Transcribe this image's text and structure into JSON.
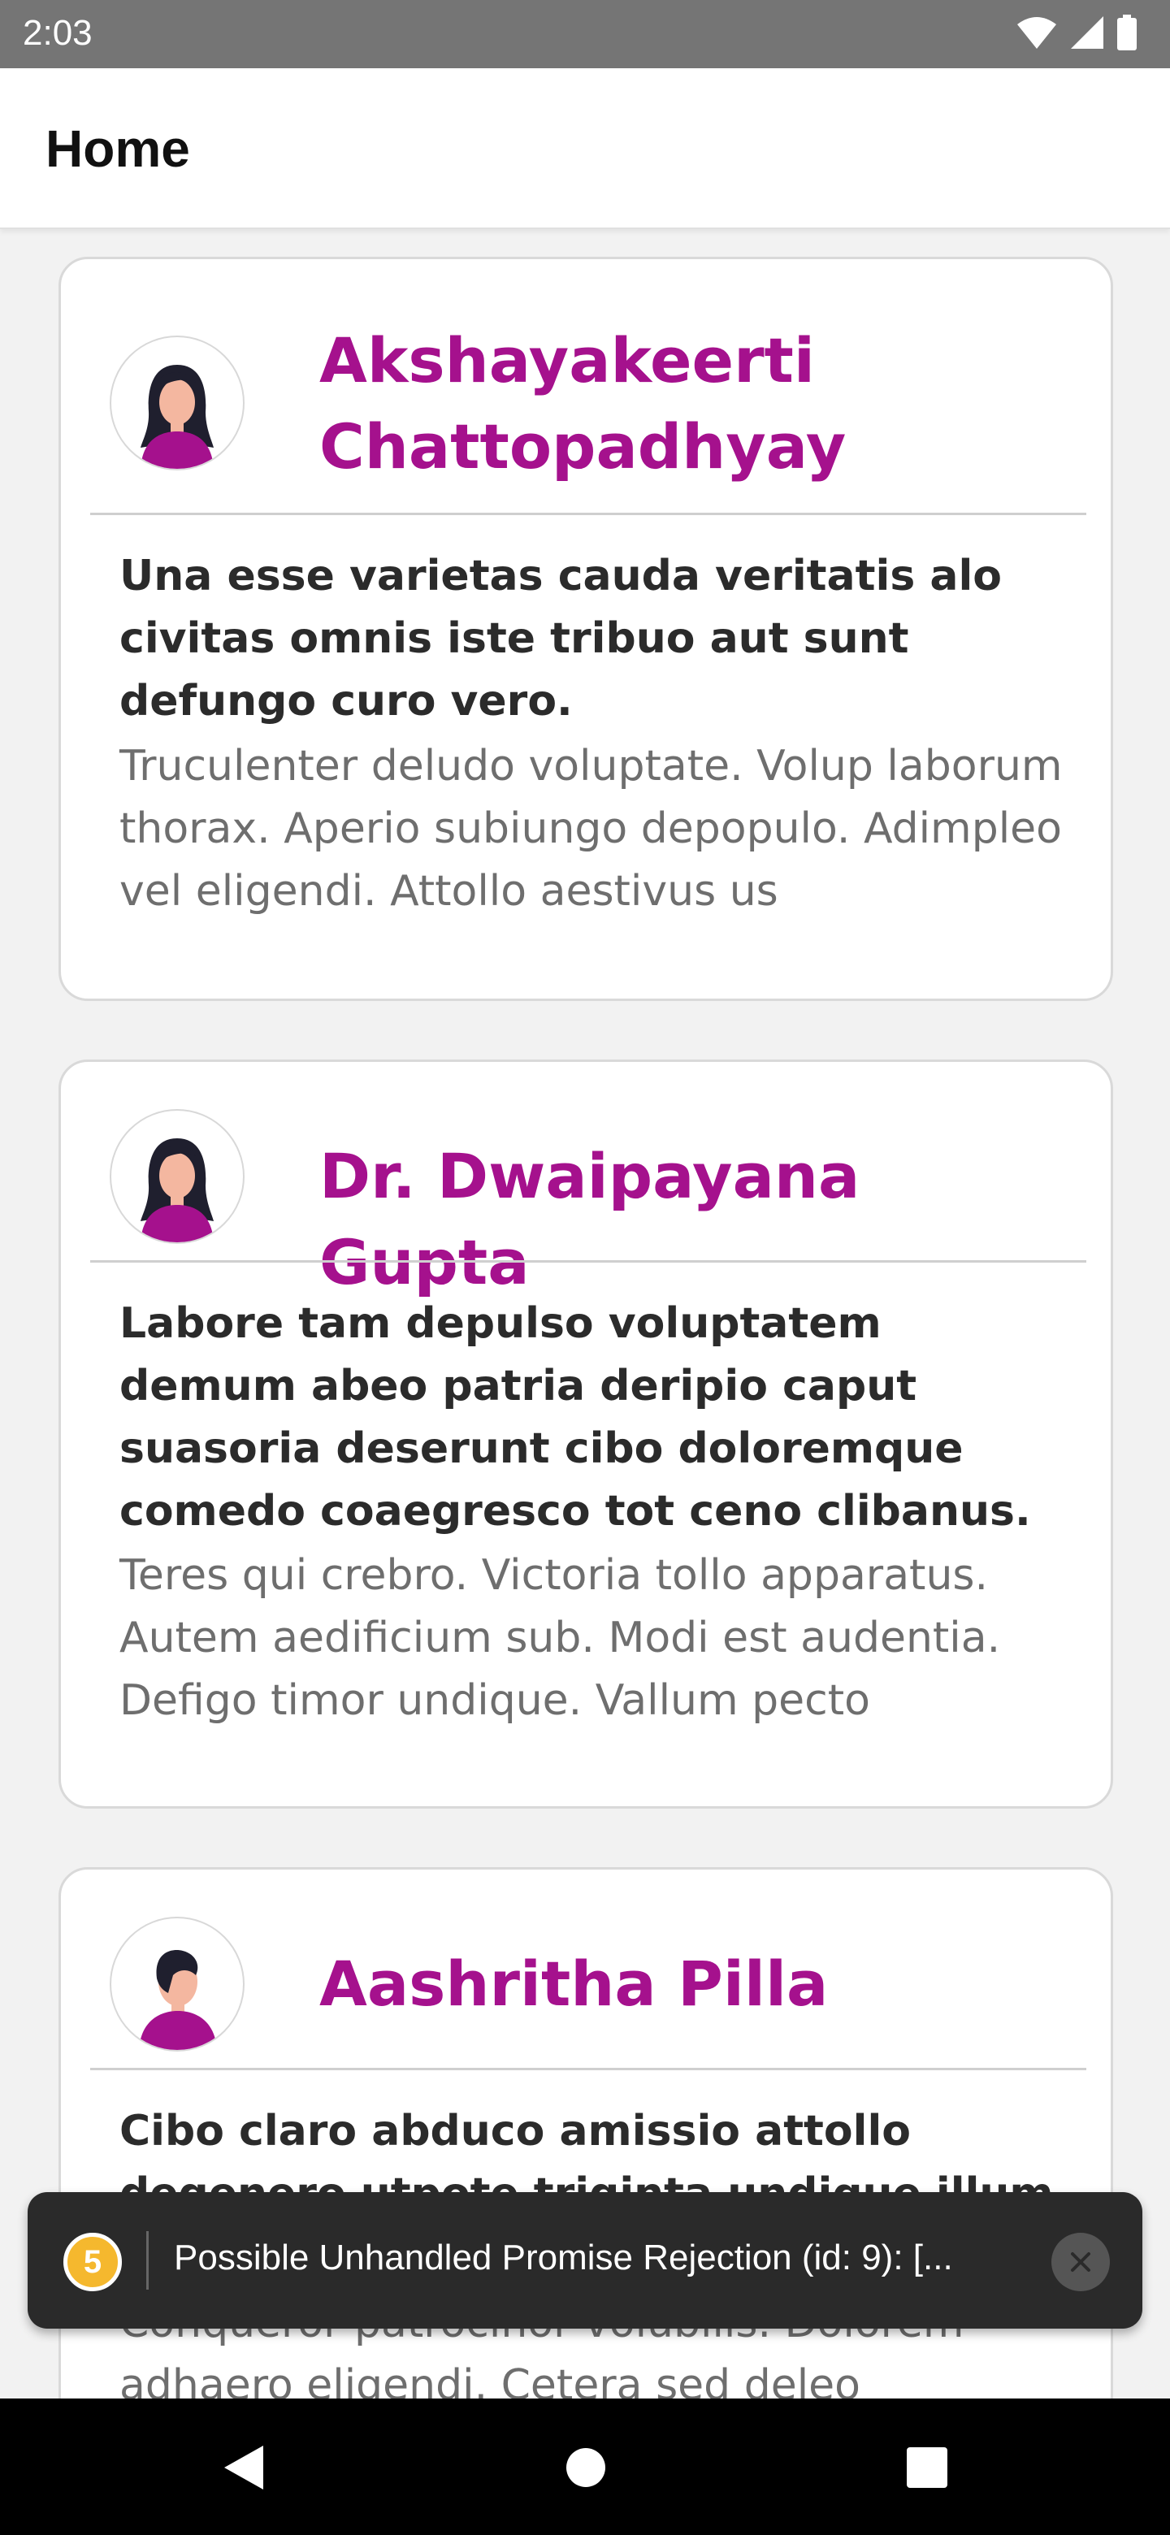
{
  "status_bar": {
    "time": "2:03",
    "icons": [
      "wifi-icon",
      "signal-icon",
      "battery-icon"
    ]
  },
  "app_bar": {
    "title": "Home"
  },
  "posts": [
    {
      "author": "Akshayakeerti Chattopadhyay",
      "avatar": "avatar-woman-long-hair",
      "title": "Una esse varietas cauda veritatis alo civitas omnis iste tribuo aut sunt defungo curo vero.",
      "body": "Truculenter deludo voluptate. Volup laborum thorax. Aperio subiungo depopulo. Adimpleo vel eligendi. Attollo aestivus us"
    },
    {
      "author": "Dr. Dwaipayana Gupta",
      "avatar": "avatar-woman-long-hair",
      "title": "Labore tam depulso voluptatem demum abeo patria deripio caput suasoria deserunt cibo doloremque comedo coaegresco tot ceno clibanus.",
      "body": "Teres qui crebro. Victoria tollo apparatus. Autem aedificium sub. Modi est audentia. Defigo timor undique. Vallum pecto"
    },
    {
      "author": "Aashritha Pilla",
      "avatar": "avatar-man-short-hair",
      "title": "Cibo claro abduco amissio attollo degenero utpote triginta undique illum",
      "body": "Conqueror patrocinor volubilis. Dolorem adhaero eligendi. Cetera sed deleo"
    }
  ],
  "toast": {
    "count": "5",
    "message": "Possible Unhandled Promise Rejection (id: 9): [..."
  },
  "nav": {
    "icons": [
      "back-icon",
      "home-icon",
      "recents-icon"
    ]
  },
  "colors": {
    "accent": "#a5118d",
    "status_bar": "#757575",
    "toast_badge": "#f5b82e"
  }
}
